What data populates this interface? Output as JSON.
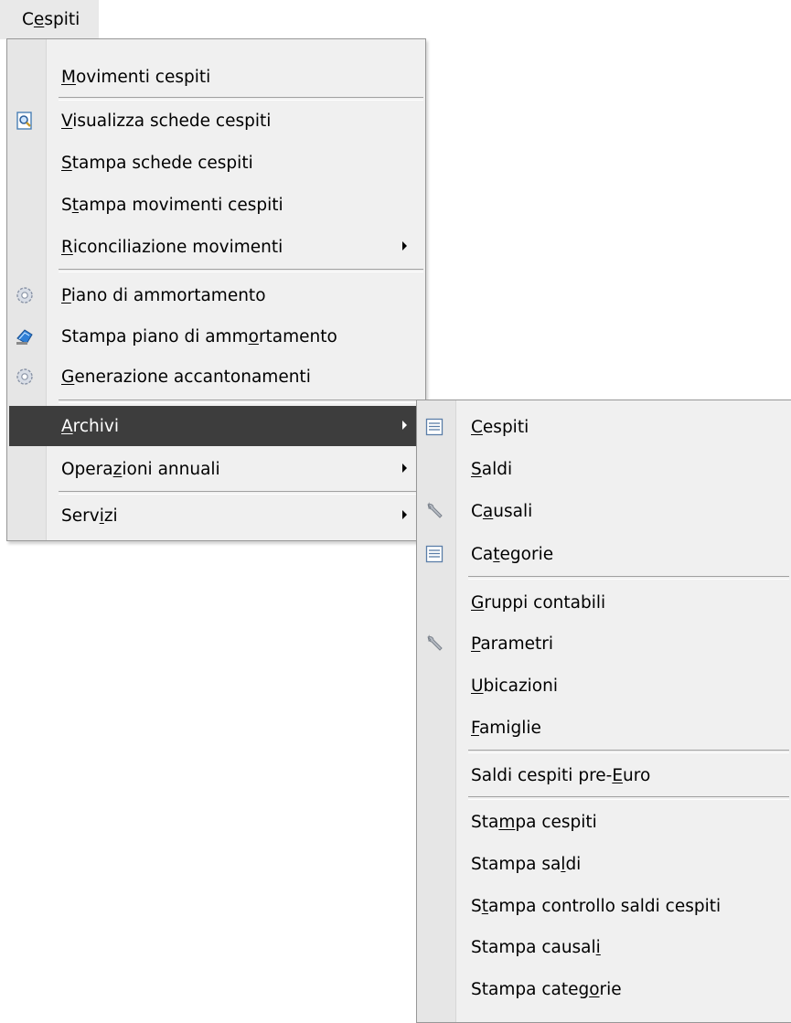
{
  "menubar": {
    "title_pre": "C",
    "title_acc": "e",
    "title_post": "spiti"
  },
  "main_menu": {
    "items": [
      {
        "pre": "",
        "acc": "M",
        "post": "ovimenti cespiti",
        "icon": ""
      },
      {
        "pre": "",
        "acc": "V",
        "post": "isualizza schede cespiti",
        "icon": "magnifier-document-icon"
      },
      {
        "pre": "",
        "acc": "S",
        "post": "tampa schede cespiti",
        "icon": ""
      },
      {
        "pre": "S",
        "acc": "t",
        "post": "ampa movimenti cespiti",
        "icon": ""
      },
      {
        "pre": "",
        "acc": "R",
        "post": "iconciliazione movimenti",
        "icon": "",
        "submenu": true
      },
      {
        "pre": "",
        "acc": "P",
        "post": "iano di ammortamento",
        "icon": "gear-icon"
      },
      {
        "pre": "Stampa piano di amm",
        "acc": "o",
        "post": "rtamento",
        "icon": "printer-blue-icon"
      },
      {
        "pre": "",
        "acc": "G",
        "post": "enerazione accantonamenti",
        "icon": "gear-icon"
      },
      {
        "pre": "",
        "acc": "A",
        "post": "rchivi",
        "icon": "",
        "submenu": true,
        "active": true
      },
      {
        "pre": "Opera",
        "acc": "z",
        "post": "ioni annuali",
        "icon": "",
        "submenu": true
      },
      {
        "pre": "Serv",
        "acc": "i",
        "post": "zi",
        "icon": "",
        "submenu": true
      }
    ]
  },
  "archivi_submenu": {
    "items": [
      {
        "pre": "",
        "acc": "C",
        "post": "espiti",
        "icon": "list-document-icon"
      },
      {
        "pre": "",
        "acc": "S",
        "post": "aldi",
        "icon": ""
      },
      {
        "pre": "C",
        "acc": "a",
        "post": "usali",
        "icon": "wrench-icon"
      },
      {
        "pre": "Ca",
        "acc": "t",
        "post": "egorie",
        "icon": "list-document-icon"
      },
      {
        "pre": "",
        "acc": "G",
        "post": "ruppi contabili",
        "icon": ""
      },
      {
        "pre": "",
        "acc": "P",
        "post": "arametri",
        "icon": "wrench-icon"
      },
      {
        "pre": "",
        "acc": "U",
        "post": "bicazioni",
        "icon": ""
      },
      {
        "pre": "",
        "acc": "F",
        "post": "amiglie",
        "icon": ""
      },
      {
        "pre": "Saldi cespiti pre-",
        "acc": "E",
        "post": "uro",
        "icon": ""
      },
      {
        "pre": "Sta",
        "acc": "m",
        "post": "pa cespiti",
        "icon": ""
      },
      {
        "pre": "Stampa sa",
        "acc": "l",
        "post": "di",
        "icon": ""
      },
      {
        "pre": "S",
        "acc": "t",
        "post": "ampa controllo saldi cespiti",
        "icon": ""
      },
      {
        "pre": "Stampa causal",
        "acc": "i",
        "post": "",
        "icon": ""
      },
      {
        "pre": "Stampa categ",
        "acc": "o",
        "post": "rie",
        "icon": ""
      }
    ]
  }
}
